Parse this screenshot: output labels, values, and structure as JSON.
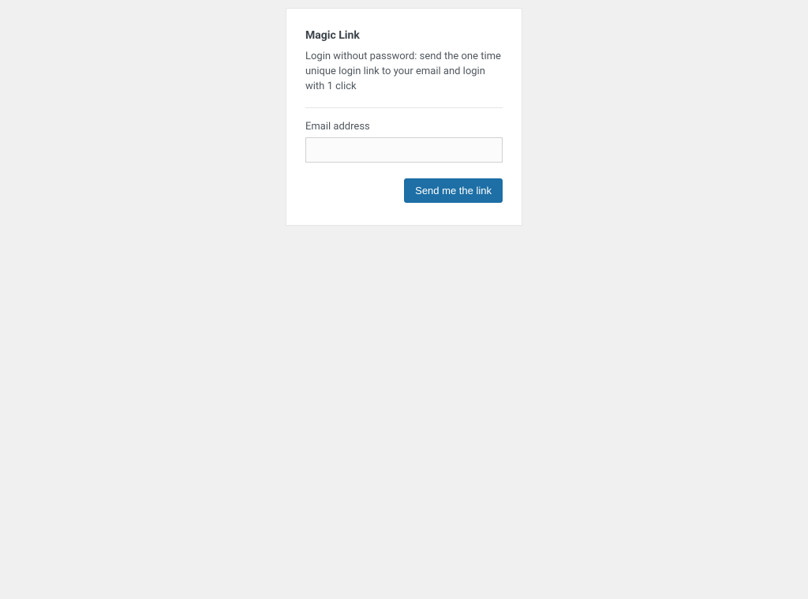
{
  "card": {
    "title": "Magic Link",
    "description": "Login without password: send the one time unique login link to your email and login with 1 click",
    "email_label": "Email address",
    "email_value": "",
    "submit_label": "Send me the link"
  }
}
